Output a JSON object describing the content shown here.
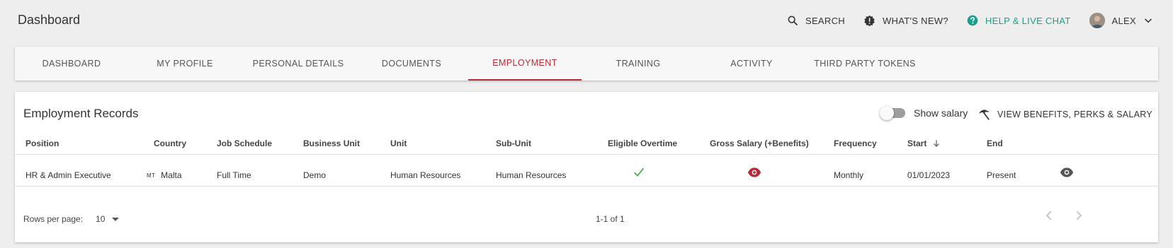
{
  "header": {
    "title": "Dashboard",
    "search_label": "SEARCH",
    "whats_new_label": "WHAT'S NEW?",
    "help_label": "HELP & LIVE CHAT",
    "user_name": "ALEX",
    "help_color": "#1e9e8a"
  },
  "tabs": [
    {
      "label": "DASHBOARD"
    },
    {
      "label": "MY PROFILE"
    },
    {
      "label": "PERSONAL DETAILS"
    },
    {
      "label": "DOCUMENTS"
    },
    {
      "label": "EMPLOYMENT",
      "active": true
    },
    {
      "label": "TRAINING"
    },
    {
      "label": "ACTIVITY"
    },
    {
      "label": "THIRD PARTY TOKENS"
    }
  ],
  "records": {
    "title": "Employment Records",
    "show_salary_label": "Show salary",
    "show_salary_on": false,
    "benefits_button": "VIEW BENEFITS, PERKS & SALARY",
    "columns": [
      "Position",
      "Country",
      "Job Schedule",
      "Business Unit",
      "Unit",
      "Sub-Unit",
      "Eligible Overtime",
      "Gross Salary (+Benefits)",
      "Frequency",
      "Start",
      "End"
    ],
    "sorted_column": "Start",
    "rows": [
      {
        "position": "HR & Admin Executive",
        "country_code": "MT",
        "country": "Malta",
        "job_schedule": "Full Time",
        "business_unit": "Demo",
        "unit": "Human Resources",
        "sub_unit": "Human Resources",
        "eligible_overtime_icon": "check-icon",
        "gross_salary_icon": "eye-icon",
        "frequency": "Monthly",
        "start": "01/01/2023",
        "end": "Present"
      }
    ],
    "footer": {
      "rows_per_page_label": "Rows per page:",
      "rows_per_page_value": "10",
      "range": "1-1 of 1"
    }
  },
  "colors": {
    "accent": "#b52b3a",
    "check": "#4caf50",
    "background": "#eeeeee"
  }
}
